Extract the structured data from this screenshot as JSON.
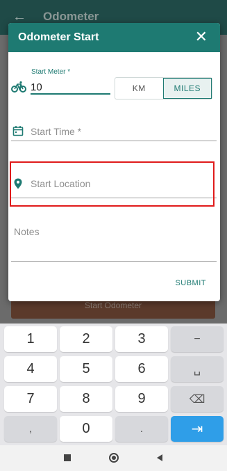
{
  "appbar": {
    "back_icon": "arrow-left-icon",
    "title": "Odometer"
  },
  "background": {
    "start_button_label": "Start Odometer"
  },
  "dialog": {
    "title": "Odometer Start",
    "close_glyph": "✕",
    "start_meter": {
      "label": "Start Meter *",
      "value": "10",
      "icon": "bicycle-icon"
    },
    "units": [
      {
        "label": "KM",
        "selected": false
      },
      {
        "label": "MILES",
        "selected": true
      }
    ],
    "start_time": {
      "placeholder": "Start Time *",
      "icon": "calendar-icon"
    },
    "start_location": {
      "placeholder": "Start Location",
      "icon": "location-pin-icon"
    },
    "notes": {
      "placeholder": "Notes"
    },
    "submit_label": "SUBMIT"
  },
  "keyboard": {
    "keys": [
      "1",
      "2",
      "3",
      "−",
      "4",
      "5",
      "6",
      "␣",
      "7",
      "8",
      "9",
      "⌫",
      ",",
      "0",
      ".",
      "⇥"
    ]
  },
  "colors": {
    "primary": "#1e7a72",
    "highlight": "#e01b1b",
    "key_go": "#2f9ee8"
  }
}
